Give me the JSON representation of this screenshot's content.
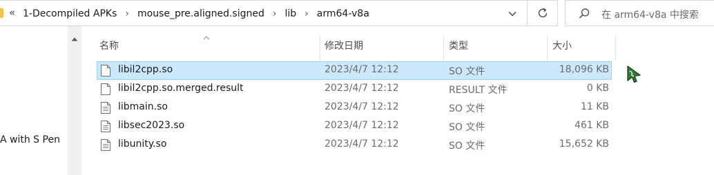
{
  "address_bar": {
    "overflow": "«",
    "breadcrumbs": [
      "1-Decompiled APKs",
      "mouse_pre.aligned.signed",
      "lib",
      "arm64-v8a"
    ],
    "separator": "›"
  },
  "search": {
    "placeholder": "在 arm64-v8a 中搜索"
  },
  "nav": {
    "partial_item": "A with S Pen"
  },
  "columns": {
    "name": "名称",
    "date": "修改日期",
    "type": "类型",
    "size": "大小"
  },
  "files": [
    {
      "name": "libil2cpp.so",
      "date": "2023/4/7 12:12",
      "type": "SO 文件",
      "size": "18,096 KB",
      "selected": true
    },
    {
      "name": "libil2cpp.so.merged.result",
      "date": "2023/4/7 12:12",
      "type": "RESULT 文件",
      "size": "0 KB",
      "selected": false
    },
    {
      "name": "libmain.so",
      "date": "2023/4/7 12:12",
      "type": "SO 文件",
      "size": "11 KB",
      "selected": false
    },
    {
      "name": "libsec2023.so",
      "date": "2023/4/7 12:12",
      "type": "SO 文件",
      "size": "461 KB",
      "selected": false
    },
    {
      "name": "libunity.so",
      "date": "2023/4/7 12:12",
      "type": "SO 文件",
      "size": "15,652 KB",
      "selected": false
    }
  ],
  "icons": {
    "overflow": "double-chevron-left-icon",
    "dropdown": "chevron-down-icon",
    "refresh": "refresh-icon",
    "search": "search-icon",
    "scroll_up": "chevron-up-icon",
    "file": "file-icon",
    "cursor": "cursor-icon"
  },
  "colors": {
    "selection_bg": "#cce8ff",
    "selection_border": "#99d1ff",
    "cursor_green": "#2e7d32"
  }
}
